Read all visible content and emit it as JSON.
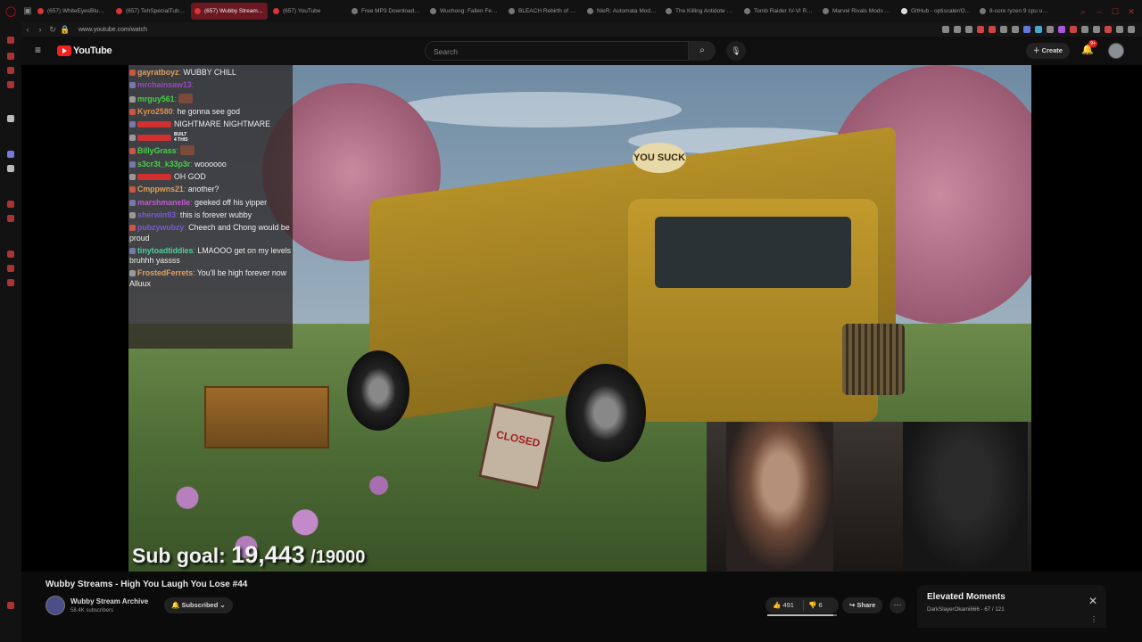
{
  "browser": {
    "tabs": [
      {
        "label": "(657) WhiteEyesBlueB...",
        "active": false
      },
      {
        "label": "(657) TehSpecialTubb...",
        "active": false
      },
      {
        "label": "(657) Wubby Stream...",
        "active": true
      },
      {
        "label": "(657) YouTube",
        "active": false
      },
      {
        "label": "Free MP3 Downloader...",
        "active": false
      },
      {
        "label": "Wuchong: Fallen Feath...",
        "active": false
      },
      {
        "label": "BLEACH Rebirth of So...",
        "active": false
      },
      {
        "label": "NieR: Automata Mods...",
        "active": false
      },
      {
        "label": "The Killing Antidote M...",
        "active": false
      },
      {
        "label": "Tomb Raider IV-VI Re...",
        "active": false
      },
      {
        "label": "Marvel Rivals Mods - ...",
        "active": false
      },
      {
        "label": "GitHub - optiscaler/O...",
        "active": false
      },
      {
        "label": "8-core ryzen 9 cpu un...",
        "active": false
      }
    ],
    "url": "www.youtube.com/watch"
  },
  "youtube": {
    "logo_text": "YouTube",
    "search_placeholder": "Search",
    "create_label": "Create",
    "notification_badge": "9+"
  },
  "chat": [
    {
      "user": "gayratboyz",
      "text": "WUBBY CHILL",
      "color": "#e0a060"
    },
    {
      "user": "mrchainsaw13",
      "text": "",
      "color": "#9a4ac0"
    },
    {
      "user": "mrguy561",
      "text": "",
      "color": "#4ad04a",
      "emote": true
    },
    {
      "user": "Kyro2580",
      "text": "he gonna see god",
      "color": "#e09050"
    },
    {
      "user": "",
      "text": "NIGHTMARE NIGHTMARE",
      "color": "#d03030",
      "badge_user": true
    },
    {
      "user": "",
      "text": "",
      "color": "#d03030",
      "built": true
    },
    {
      "user": "BillyGrass",
      "text": "",
      "color": "#4ad04a",
      "emote": true
    },
    {
      "user": "s3cr3t_k33p3r",
      "text": "woooooo",
      "color": "#4ad04a"
    },
    {
      "user": "",
      "text": "OH GOD",
      "color": "#d03030"
    },
    {
      "user": "Cmppwns21",
      "text": "another?",
      "color": "#e0a060"
    },
    {
      "user": "marshmanelle",
      "text": "geeked off his yipper",
      "color": "#c05ad0"
    },
    {
      "user": "sherwin93",
      "text": "this is forever wubby",
      "color": "#7a5ad0"
    },
    {
      "user": "pubzywubzy",
      "text": "Cheech and Chong would be proud",
      "color": "#7a5ad0"
    },
    {
      "user": "tinytoadtiddies",
      "text": "LMAOOO get on my levels bruhhh yassss",
      "color": "#4ad0a0"
    },
    {
      "user": "FrostedFerrets",
      "text": "You'll be high forever now Alluux",
      "color": "#e0a060"
    }
  ],
  "overlay": {
    "built_line1": "BUILT",
    "built_line2": "4 THIS",
    "bus_sign": "YOU SUCK",
    "closed_sign": "CLOSED",
    "sub_goal_label": "Sub goal:",
    "sub_goal_current": "19,443",
    "sub_goal_target": "/19000"
  },
  "video": {
    "title": "Wubby Streams - High You Laugh You Lose #44",
    "channel_name": "Wubby Stream Archive",
    "channel_subs": "58.4K subscribers",
    "subscribed_label": "Subscribed",
    "likes": "491",
    "dislikes": "6",
    "like_ratio": 0.95,
    "share_label": "Share"
  },
  "playlist": {
    "title": "Elevated Moments",
    "owner": "DarkSlayerOkami666",
    "position": "67 / 121"
  },
  "colors": {
    "youtube_red": "#ff0000",
    "active_tab": "#6a1822",
    "background": "#0f0f0f"
  }
}
